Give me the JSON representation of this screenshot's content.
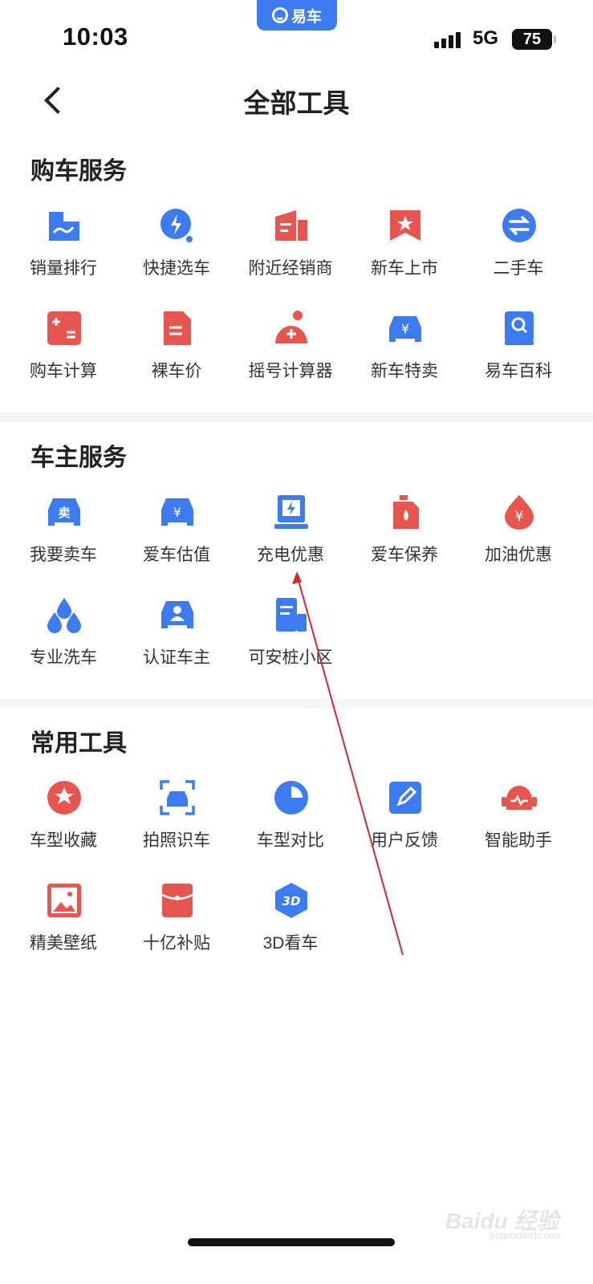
{
  "status": {
    "time": "10:03",
    "app_badge": "易车",
    "network": "5G",
    "battery": "75"
  },
  "nav": {
    "title": "全部工具"
  },
  "sections": [
    {
      "title": "购车服务",
      "items": [
        {
          "label": "销量排行",
          "icon": "sales-rank-icon"
        },
        {
          "label": "快捷选车",
          "icon": "quick-select-icon"
        },
        {
          "label": "附近经销商",
          "icon": "dealer-icon"
        },
        {
          "label": "新车上市",
          "icon": "new-car-launch-icon"
        },
        {
          "label": "二手车",
          "icon": "used-car-icon"
        },
        {
          "label": "购车计算",
          "icon": "calculator-icon"
        },
        {
          "label": "裸车价",
          "icon": "price-doc-icon"
        },
        {
          "label": "摇号计算器",
          "icon": "lottery-icon"
        },
        {
          "label": "新车特卖",
          "icon": "car-sale-icon"
        },
        {
          "label": "易车百科",
          "icon": "encyclopedia-icon"
        }
      ]
    },
    {
      "title": "车主服务",
      "items": [
        {
          "label": "我要卖车",
          "icon": "sell-car-icon"
        },
        {
          "label": "爱车估值",
          "icon": "valuation-icon"
        },
        {
          "label": "充电优惠",
          "icon": "charging-icon"
        },
        {
          "label": "爱车保养",
          "icon": "oil-can-icon"
        },
        {
          "label": "加油优惠",
          "icon": "fuel-drop-icon"
        },
        {
          "label": "专业洗车",
          "icon": "car-wash-icon"
        },
        {
          "label": "认证车主",
          "icon": "verified-owner-icon"
        },
        {
          "label": "可安桩小区",
          "icon": "charging-pile-icon"
        }
      ]
    },
    {
      "title": "常用工具",
      "items": [
        {
          "label": "车型收藏",
          "icon": "favorite-icon"
        },
        {
          "label": "拍照识车",
          "icon": "scan-car-icon"
        },
        {
          "label": "车型对比",
          "icon": "compare-icon"
        },
        {
          "label": "用户反馈",
          "icon": "feedback-icon"
        },
        {
          "label": "智能助手",
          "icon": "assistant-icon"
        },
        {
          "label": "精美壁纸",
          "icon": "wallpaper-icon"
        },
        {
          "label": "十亿补贴",
          "icon": "subsidy-icon"
        },
        {
          "label": "3D看车",
          "icon": "3d-view-icon"
        }
      ]
    }
  ],
  "watermark": {
    "text": "Baidu 经验",
    "sub": "jingyan.baidu.com"
  },
  "colors": {
    "blue": "#3d7bf0",
    "red": "#e8544e",
    "divider": "#f4f6fa",
    "annotation": "#d8262b"
  }
}
